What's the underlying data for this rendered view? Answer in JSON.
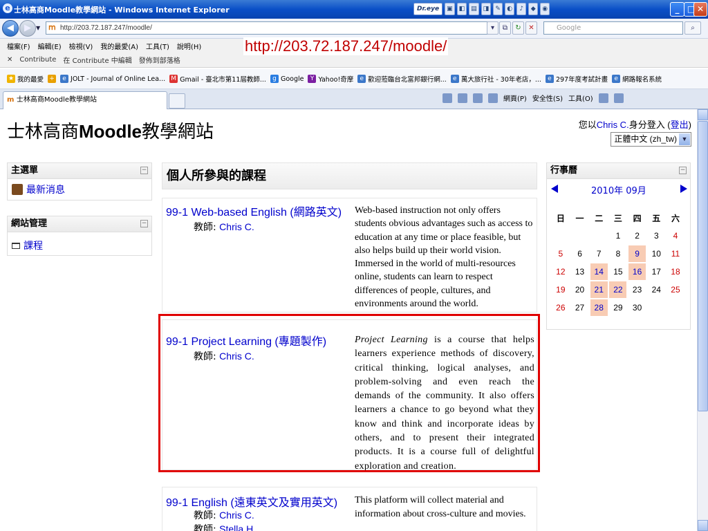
{
  "window": {
    "title": "士林高商Moodle教學網站 - Windows Internet Explorer",
    "tools": [
      "Dr.eye"
    ]
  },
  "address": {
    "url": "http://203.72.187.247/moodle/",
    "search_placeholder": "Google"
  },
  "menubar": [
    "檔案(F)",
    "編輯(E)",
    "檢視(V)",
    "我的最愛(A)",
    "工具(T)",
    "說明(H)"
  ],
  "contribute": [
    "Contribute",
    "在 Contribute 中編輯",
    "發佈到部落格"
  ],
  "overlay_url": "http://203.72.187.247/moodle/",
  "favorites": {
    "label": "我的最愛",
    "items": [
      "JOLT - Journal of Online Lea...",
      "Gmail - 臺北市第11屆教師...",
      "Google",
      "Yahoo!奇摩",
      "歡迎蒞臨台北富邦銀行網...",
      "萬大旅行社 - 30年老店，...",
      "297年度考試計畫",
      "網路報名系統"
    ]
  },
  "tab": {
    "title": "士林高商Moodle教學網站"
  },
  "cmdbar": [
    "網頁(P)",
    "安全性(S)",
    "工具(O)"
  ],
  "site": {
    "title_a": "士林高商",
    "title_b": "Moodle",
    "title_c": "教學網站",
    "login_prefix": "您以",
    "login_user": "Chris C.",
    "login_mid": "身分登入 (",
    "logout": "登出",
    "login_suffix": ")",
    "language": "正體中文 (zh_tw)"
  },
  "blocks": {
    "main_menu": {
      "title": "主選單",
      "item": "最新消息"
    },
    "site_admin": {
      "title": "網站管理",
      "item": "課程"
    }
  },
  "courses_heading": "個人所參與的課程",
  "courses": [
    {
      "name": "99-1 Web-based English (網路英文)",
      "teacher_label": "教師:",
      "teachers": [
        "Chris C."
      ],
      "desc": "Web-based instruction not only offers students obvious advantages such as access to education at any time or place feasible, but also helps build up their world vision. Immersed in the world of multi-resources online, students can learn to respect differences of people, cultures, and environments around the world."
    },
    {
      "name": "99-1 Project Learning (專題製作)",
      "teacher_label": "教師:",
      "teachers": [
        "Chris C."
      ],
      "desc_em": "Project Learning",
      "desc": " is a course that helps learners experience methods of discovery, critical thinking, logical analyses, and problem-solving and even reach the demands of the community. It also offers learners a chance to go beyond what they know and think and incorporate ideas by others, and to present their integrated products. It is a course full of delightful exploration and creation."
    },
    {
      "name": "99-1 English (遠東英文及實用英文)",
      "teacher_label": "教師:",
      "teachers": [
        "Chris C.",
        "Stella H."
      ],
      "desc": "This platform will collect material and information about cross-culture and movies."
    }
  ],
  "calendar": {
    "title": "行事曆",
    "month": "2010年 09月",
    "weekdays": [
      "日",
      "一",
      "二",
      "三",
      "四",
      "五",
      "六"
    ],
    "weeks": [
      [
        "",
        "",
        "",
        "1",
        "2",
        "3",
        "4"
      ],
      [
        "5",
        "6",
        "7",
        "8",
        "9",
        "10",
        "11"
      ],
      [
        "12",
        "13",
        "14",
        "15",
        "16",
        "17",
        "18"
      ],
      [
        "19",
        "20",
        "21",
        "22",
        "23",
        "24",
        "25"
      ],
      [
        "26",
        "27",
        "28",
        "29",
        "30",
        "",
        ""
      ]
    ],
    "event_days": [
      "9",
      "14",
      "16",
      "21",
      "22",
      "28"
    ]
  }
}
